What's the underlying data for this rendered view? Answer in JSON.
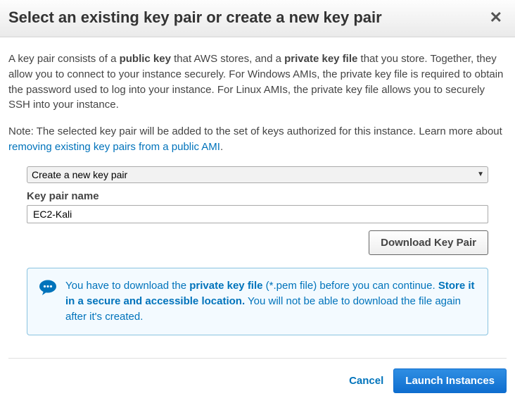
{
  "modal": {
    "title": "Select an existing key pair or create a new key pair"
  },
  "body": {
    "para1_a": "A key pair consists of a ",
    "para1_b_bold": "public key",
    "para1_c": " that AWS stores, and a ",
    "para1_d_bold": "private key file",
    "para1_e": " that you store. Together, they allow you to connect to your instance securely. For Windows AMIs, the private key file is required to obtain the password used to log into your instance. For Linux AMIs, the private key file allows you to securely SSH into your instance.",
    "note_a": "Note: The selected key pair will be added to the set of keys authorized for this instance. Learn more about ",
    "note_link": "removing existing key pairs from a public AMI",
    "note_b": "."
  },
  "form": {
    "select_value": "Create a new key pair",
    "select_options": [
      "Create a new key pair"
    ],
    "field_label": "Key pair name",
    "input_value": "EC2-Kali",
    "download_label": "Download Key Pair"
  },
  "info": {
    "a": "You have to download the ",
    "b_bold": "private key file",
    "c": " (*.pem file) before you can continue. ",
    "d_bold": "Store it in a secure and accessible location.",
    "e": " You will not be able to download the file again after it's created."
  },
  "footer": {
    "cancel": "Cancel",
    "launch": "Launch Instances"
  }
}
